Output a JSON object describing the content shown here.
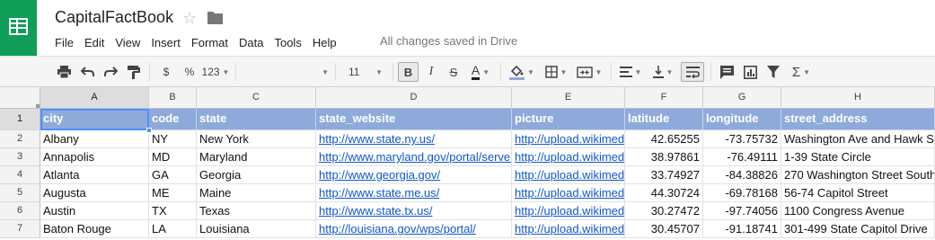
{
  "app": {
    "title": "CapitalFactBook",
    "status": "All changes saved in Drive"
  },
  "menu": [
    "File",
    "Edit",
    "View",
    "Insert",
    "Format",
    "Data",
    "Tools",
    "Help"
  ],
  "toolbar": {
    "currency": "$",
    "percent": "%",
    "number_format": "123",
    "font_size": "11",
    "bold": "B",
    "italic": "I",
    "strike": "S",
    "text_color": "A",
    "functions": "Σ"
  },
  "columns": [
    "A",
    "B",
    "C",
    "D",
    "E",
    "F",
    "G",
    "H"
  ],
  "rows": [
    [
      "city",
      "code",
      "state",
      "state_website",
      "picture",
      "latitude",
      "longitude",
      "street_address"
    ],
    [
      "Albany",
      "NY",
      "New York",
      "http://www.state.ny.us/",
      "http://upload.wikimedia",
      "42.65255",
      "-73.75732",
      "Washington Ave and Hawk St"
    ],
    [
      "Annapolis",
      "MD",
      "Maryland",
      "http://www.maryland.gov/portal/server",
      "http://upload.wikimedia",
      "38.97861",
      "-76.49111",
      "1-39 State Circle"
    ],
    [
      "Atlanta",
      "GA",
      "Georgia",
      "http://www.georgia.gov/",
      "http://upload.wikimedia",
      "33.74927",
      "-84.38826",
      "270 Washington Street South"
    ],
    [
      "Augusta",
      "ME",
      "Maine",
      "http://www.state.me.us/",
      "http://upload.wikimedia",
      "44.30724",
      "-69.78168",
      "56-74 Capitol Street"
    ],
    [
      "Austin",
      "TX",
      "Texas",
      "http://www.state.tx.us/",
      "http://upload.wikimedia",
      "30.27472",
      "-97.74056",
      "1100 Congress Avenue"
    ],
    [
      "Baton Rouge",
      "LA",
      "Louisiana",
      "http://louisiana.gov/wps/portal/",
      "http://upload.wikimedia",
      "30.45707",
      "-91.18741",
      "301-499 State Capitol Drive"
    ]
  ],
  "row_numbers": [
    "1",
    "2",
    "3",
    "4",
    "5",
    "6",
    "7"
  ],
  "colors": {
    "brand": "#0f9d58",
    "header_fill": "#8eaadb",
    "link": "#1155cc",
    "selection": "#4d90fe"
  }
}
